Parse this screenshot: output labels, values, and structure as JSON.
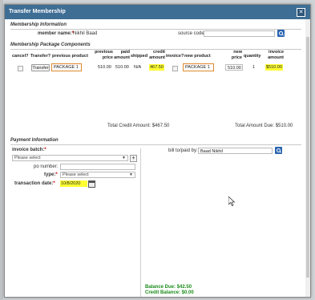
{
  "modal": {
    "title": "Transfer Membership"
  },
  "membership_info": {
    "heading": "Membership Information",
    "member_name_label": "member name:",
    "member_name_value": "Nikhil Baad",
    "source_code_label": "source code:",
    "source_code_value": ""
  },
  "package_components": {
    "heading": "Membership Package Components",
    "headers": {
      "cancel": "cancel?",
      "transfer": "Transfer?",
      "previous_product": "previous product",
      "previous_price_1": "previous",
      "previous_price_2": "price",
      "paid_amount_1": "paid",
      "paid_amount_2": "amount",
      "shipped": "shipped",
      "credit_amount_1": "credit",
      "credit_amount_2": "amount",
      "invoice": "invoice?",
      "new_product": "new product",
      "new_price_1": "new",
      "new_price_2": "price",
      "quantity": "quantity",
      "invoice_amount_1": "invoice",
      "invoice_amount_2": "amount"
    },
    "row": {
      "transfer_button": "Transfer",
      "previous_product": "PACKAGE 1",
      "previous_price": "510.00",
      "paid_amount": "510.00",
      "shipped": "N/A",
      "credit_amount": "467.50",
      "new_product": "PACKAGE 1",
      "new_price": "510.00",
      "quantity": "1",
      "invoice_amount": "$510.00"
    },
    "total_credit": "Total Credit Amount: $467.50",
    "total_amount_due": "Total Amount Due: $510.00"
  },
  "payment_info": {
    "heading": "Payment Information",
    "invoice_batch_label": "invoice batch:",
    "invoice_batch_value": "Please select",
    "po_number_label": "po number:",
    "po_number_value": "",
    "type_label": "type:",
    "type_value": "Please select",
    "transaction_date_label": "transaction date:",
    "transaction_date_value": "10/8/2020",
    "bill_to_label": "bill to/paid by:",
    "bill_to_value": "Baad Nikhil",
    "balance_due": "Balance Due: $42.50",
    "credit_balance": "Credit Balance: $0.00"
  },
  "colors": {
    "titlebar": "#3f6e95",
    "highlight": "#ffff33",
    "orange_outline": "#e08a2c",
    "green_text": "#1a8c1a"
  }
}
